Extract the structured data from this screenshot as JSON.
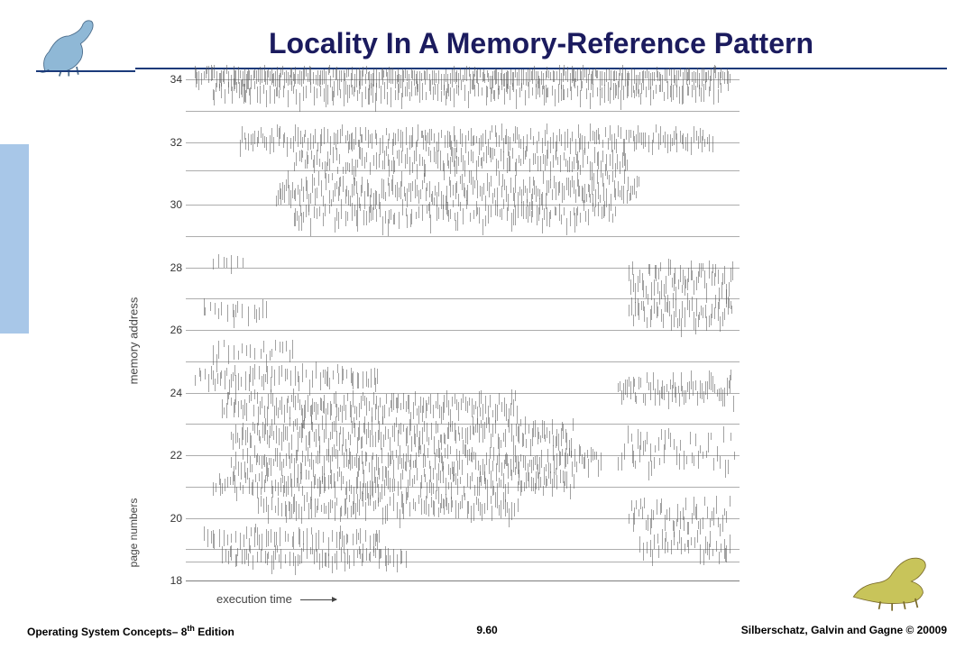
{
  "title": "Locality In A Memory-Reference Pattern",
  "chart": {
    "ylabel": "memory address",
    "ysublabel": "page numbers",
    "xlabel": "execution time",
    "yticks": [
      "34",
      "32",
      "30",
      "28",
      "26",
      "24",
      "22",
      "20",
      "18"
    ]
  },
  "footer": {
    "left_pre": "Operating System Concepts– 8",
    "left_sup": "th",
    "left_post": " Edition",
    "center": "9.60",
    "right": "Silberschatz, Galvin and Gagne © 20009"
  }
}
